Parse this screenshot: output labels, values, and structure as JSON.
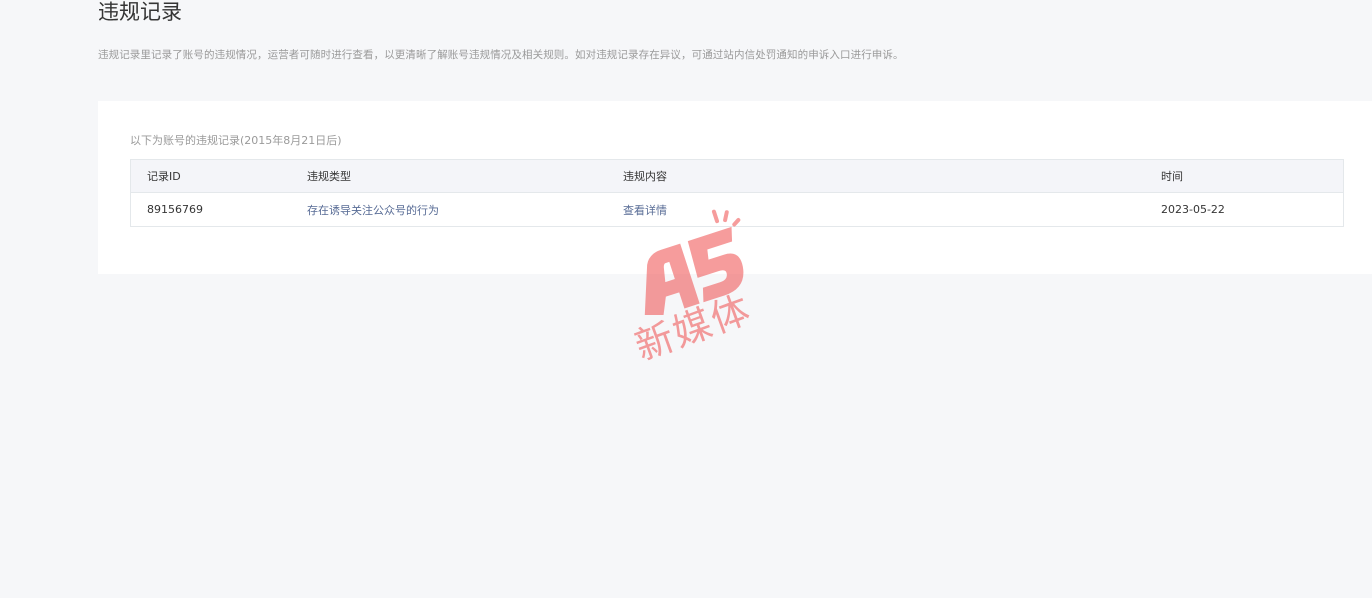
{
  "page": {
    "title": "违规记录",
    "description": "违规记录里记录了账号的违规情况，运营者可随时进行查看，以更清晰了解账号违规情况及相关规则。如对违规记录存在异议，可通过站内信处罚通知的申诉入口进行申诉。"
  },
  "records": {
    "caption": "以下为账号的违规记录(2015年8月21日后)",
    "columns": [
      "记录ID",
      "违规类型",
      "违规内容",
      "时间"
    ],
    "rows": [
      {
        "id": "89156769",
        "type": "存在诱导关注公众号的行为",
        "content": "查看详情",
        "time": "2023-05-22"
      }
    ]
  },
  "watermark": {
    "logo": "A5",
    "text": "新媒体",
    "color": "#f05a5a"
  }
}
